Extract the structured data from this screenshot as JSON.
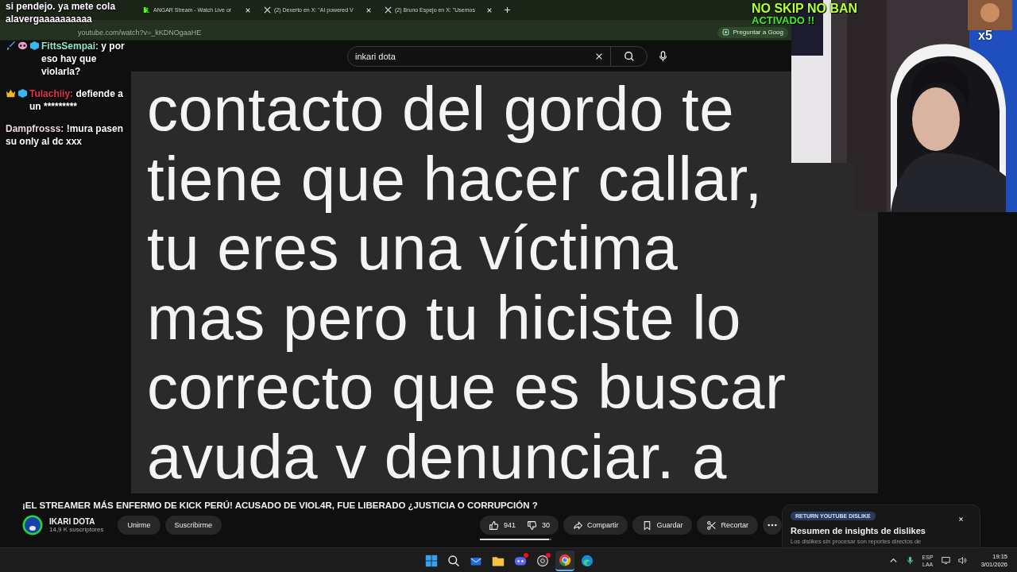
{
  "browser": {
    "tabs": [
      {
        "title": "ANGAR Stream - Watch Live or",
        "kind": "kick",
        "selected": false
      },
      {
        "title": "(2) Dexerto en X: \"AI powered V",
        "kind": "x",
        "selected": false
      },
      {
        "title": "(2) Bruno Espejo en X: \"Usemos",
        "kind": "x",
        "selected": false
      }
    ],
    "address": "youtube.com/watch?v=_kKDNOgaaHE",
    "ask_button": "Preguntar a Goog"
  },
  "youtube": {
    "search": {
      "value": "inkari dota"
    }
  },
  "video": {
    "caption_lines": [
      "contacto del gordo te",
      "tiene que hacer callar,",
      "tu eres una víctima",
      "mas pero tu hiciste lo",
      "correcto que es buscar",
      "avuda v denunciar. a"
    ]
  },
  "stream_overlay": {
    "alert_title": "NO SKIP NO BAN",
    "alert_subtitle": "ACTIVADO !!",
    "multiplier": "x5"
  },
  "chat": [
    {
      "text": "si pendejo. ya mete cola alavergaaaaaaaaaa"
    },
    {
      "badges": [
        {
          "kind": "sword"
        },
        {
          "kind": "mask"
        },
        {
          "kind": "cube"
        }
      ],
      "user": "FittsSempai:",
      "color": "#8de6c8",
      "text": "y por eso hay que violarla?"
    },
    {
      "badges": [
        {
          "kind": "crown"
        },
        {
          "kind": "cube"
        }
      ],
      "user": "Tulachiiy:",
      "color": "#e8324e",
      "text": "defiende a un *********"
    },
    {
      "user": "Dampfrosss:",
      "color": "#f3d6e6",
      "text": "!mura pasen su only al dc xxx"
    }
  ],
  "watch": {
    "title": "¡EL STREAMER MÁS ENFERMO DE KICK PERÚ! ACUSADO DE VIOL4R, FUE LIBERADO ¿JUSTICIA O CORRUPCIÓN ?",
    "channel": {
      "name": "IKARI DOTA",
      "subscribers": "14,9 K suscriptores"
    },
    "channel_buttons": [
      "Unirme",
      "Suscribirme"
    ],
    "likes": "941",
    "dislikes": "30",
    "ratio_bar": {
      "level": 0.97
    },
    "actions": [
      {
        "kind": "share",
        "label": "Compartir"
      },
      {
        "kind": "save",
        "label": "Guardar"
      },
      {
        "kind": "clip",
        "label": "Recortar"
      }
    ]
  },
  "dislike_card": {
    "badge": "RETURN YOUTUBE DISLIKE",
    "title": "Resumen de insights de dislikes",
    "text": "Los dislikes sin procesar son reportes directos de"
  },
  "taskbar": {
    "apps": [
      {
        "kind": "start",
        "active": false,
        "badge": false
      },
      {
        "kind": "search",
        "active": false,
        "badge": false
      },
      {
        "kind": "mail",
        "active": false,
        "badge": false
      },
      {
        "kind": "folder",
        "active": false,
        "badge": false
      },
      {
        "kind": "chat",
        "active": false,
        "badge": true
      },
      {
        "kind": "record",
        "active": false,
        "badge": true
      },
      {
        "kind": "chrome",
        "active": true,
        "badge": false
      },
      {
        "kind": "edge",
        "active": false,
        "badge": false
      }
    ],
    "language": [
      "ESP",
      "LAA"
    ],
    "time": "19:15",
    "date": "3/01/2026"
  }
}
